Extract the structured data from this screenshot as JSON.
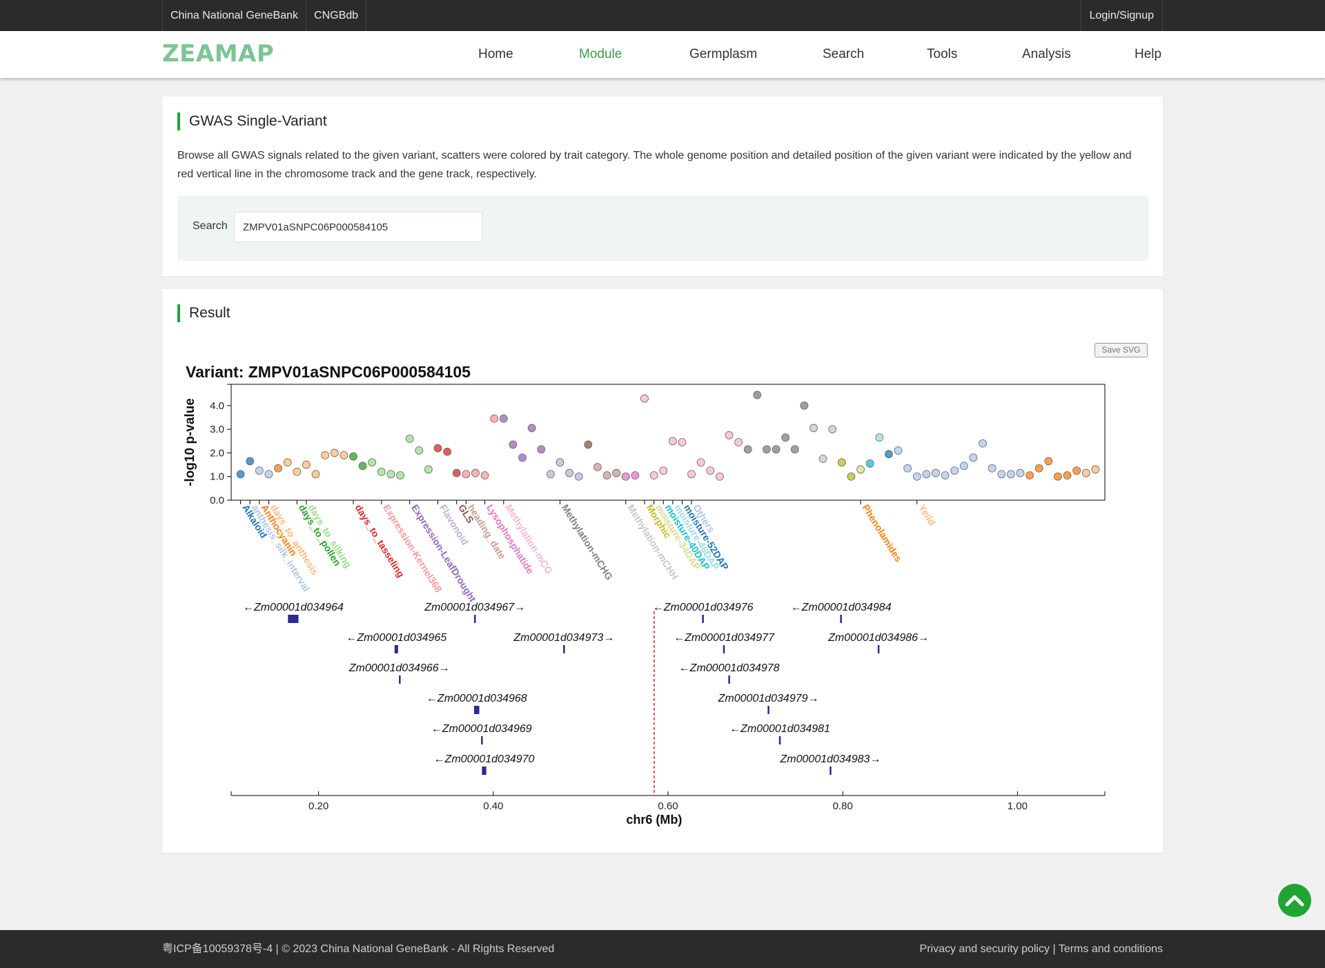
{
  "topbar": {
    "links": [
      "China National GeneBank",
      "CNGBdb"
    ],
    "login": "Login/Signup"
  },
  "header": {
    "logo": "ZEAMAP",
    "nav": [
      "Home",
      "Module",
      "Germplasm",
      "Search",
      "Tools",
      "Analysis",
      "Help"
    ],
    "active": "Module"
  },
  "section1": {
    "title": "GWAS Single-Variant",
    "description": "Browse all GWAS signals related to the given variant, scatters were colored by trait category. The whole genome position and detailed position of the given variant were indicated by the yellow and red vertical line in the chromosome track and the gene track, respectively.",
    "search_label": "Search",
    "search_value": "ZMPV01aSNPC06P000584105"
  },
  "section2": {
    "title": "Result",
    "save_button": "Save SVG"
  },
  "chart_data": [
    {
      "type": "scatter",
      "title": "Variant: ZMPV01aSNPC06P000584105",
      "ylabel": "-log10 p-value",
      "ylim": [
        0,
        4.9
      ],
      "yticks": [
        "0.0",
        "1.0",
        "2.0",
        "3.0",
        "4.0"
      ],
      "categories": [
        {
          "name": "Alkaloid",
          "color": "#1f77b4",
          "ticks": [
            1
          ],
          "labeled": true
        },
        {
          "name": "anthesis_silk_interval",
          "color": "#aec7e8",
          "ticks": [
            2
          ],
          "labeled": true
        },
        {
          "name": "Anthocyanin",
          "color": "#ff7f0e",
          "ticks": [
            3
          ],
          "labeled": true
        },
        {
          "name": "days_to_anthesis",
          "color": "#ffbb78",
          "ticks": [
            4
          ],
          "labeled": true
        },
        {
          "name": "days_to_pollen",
          "color": "#2ca02c",
          "ticks": [
            7
          ],
          "labeled": true
        },
        {
          "name": "days_to_silking",
          "color": "#98df8a",
          "ticks": [
            8
          ],
          "labeled": true
        },
        {
          "name": "days_to_tasseling",
          "color": "#d62728",
          "ticks": [
            13
          ],
          "labeled": true
        },
        {
          "name": "Expression-Kernel368",
          "color": "#ff9896",
          "ticks": [
            16
          ],
          "labeled": true
        },
        {
          "name": "Expression-LeafDrought",
          "color": "#9467bd",
          "ticks": [
            19
          ],
          "labeled": true
        },
        {
          "name": "Flavonoid",
          "color": "#c5b0d5",
          "ticks": [
            22
          ],
          "labeled": true
        },
        {
          "name": "GLS",
          "color": "#8c564b",
          "ticks": [
            24
          ],
          "labeled": true
        },
        {
          "name": "heading_date",
          "color": "#c49c94",
          "ticks": [
            25
          ],
          "labeled": true
        },
        {
          "name": "Lysophosphatide",
          "color": "#e377c2",
          "ticks": [
            27
          ],
          "labeled": true
        },
        {
          "name": "Methylation-mCG",
          "color": "#f7b6d2",
          "ticks": [
            29
          ],
          "labeled": true
        },
        {
          "name": "Methylation-mCHG",
          "color": "#7f7f7f",
          "ticks": [
            35
          ],
          "labeled": true
        },
        {
          "name": "Methylation-mCHH",
          "color": "#c7c7c7",
          "ticks": [
            42
          ],
          "labeled": true
        },
        {
          "name": "Morphic",
          "color": "#bcbd22",
          "ticks": [
            44
          ],
          "labeled": true
        },
        {
          "name": "moisture-34DAP",
          "color": "#dbdb8d",
          "ticks": [
            45
          ],
          "labeled": true
        },
        {
          "name": "moisture-40DAP",
          "color": "#17becf",
          "ticks": [
            46
          ],
          "labeled": true
        },
        {
          "name": "moisture-46DAP",
          "color": "#9edae5",
          "ticks": [
            47
          ],
          "labeled": true
        },
        {
          "name": "moisture-52DAP",
          "color": "#1f77b4",
          "ticks": [
            48
          ],
          "labeled": true
        },
        {
          "name": "Others",
          "color": "#aec7e8",
          "ticks": [
            49
          ],
          "labeled": true
        },
        {
          "name": "Phenolamides",
          "color": "#ff7f0e",
          "ticks": [
            67
          ],
          "labeled": true
        },
        {
          "name": "Yeild",
          "color": "#ffbb78",
          "ticks": [
            73
          ],
          "labeled": true
        }
      ],
      "points": [
        {
          "i": 1,
          "y": 1.1,
          "c": "#1f77b4"
        },
        {
          "i": 2,
          "y": 1.65,
          "c": "#1f77b4"
        },
        {
          "i": 3,
          "y": 1.25,
          "c": "#aec7e8"
        },
        {
          "i": 4,
          "y": 1.1,
          "c": "#aec7e8"
        },
        {
          "i": 5,
          "y": 1.35,
          "c": "#ff7f0e"
        },
        {
          "i": 6,
          "y": 1.6,
          "c": "#ffbb78"
        },
        {
          "i": 7,
          "y": 1.2,
          "c": "#ffbb78"
        },
        {
          "i": 8,
          "y": 1.5,
          "c": "#ffbb78"
        },
        {
          "i": 9,
          "y": 1.1,
          "c": "#ffbb78"
        },
        {
          "i": 10,
          "y": 1.9,
          "c": "#ffbb78"
        },
        {
          "i": 11,
          "y": 2.0,
          "c": "#ffbb78"
        },
        {
          "i": 12,
          "y": 1.9,
          "c": "#ffbb78"
        },
        {
          "i": 13,
          "y": 1.85,
          "c": "#2ca02c"
        },
        {
          "i": 14,
          "y": 1.45,
          "c": "#2ca02c"
        },
        {
          "i": 15,
          "y": 1.6,
          "c": "#98df8a"
        },
        {
          "i": 16,
          "y": 1.2,
          "c": "#98df8a"
        },
        {
          "i": 17,
          "y": 1.1,
          "c": "#98df8a"
        },
        {
          "i": 18,
          "y": 1.05,
          "c": "#98df8a"
        },
        {
          "i": 19,
          "y": 2.6,
          "c": "#98df8a"
        },
        {
          "i": 20,
          "y": 2.1,
          "c": "#98df8a"
        },
        {
          "i": 21,
          "y": 1.3,
          "c": "#98df8a"
        },
        {
          "i": 22,
          "y": 2.2,
          "c": "#d62728"
        },
        {
          "i": 23,
          "y": 2.05,
          "c": "#d62728"
        },
        {
          "i": 24,
          "y": 1.15,
          "c": "#d62728"
        },
        {
          "i": 25,
          "y": 1.1,
          "c": "#ff9896"
        },
        {
          "i": 26,
          "y": 1.15,
          "c": "#ff9896"
        },
        {
          "i": 27,
          "y": 1.05,
          "c": "#ff9896"
        },
        {
          "i": 28,
          "y": 3.45,
          "c": "#ff9896"
        },
        {
          "i": 29,
          "y": 3.45,
          "c": "#9467bd"
        },
        {
          "i": 30,
          "y": 2.35,
          "c": "#9467bd"
        },
        {
          "i": 31,
          "y": 1.8,
          "c": "#9467bd"
        },
        {
          "i": 32,
          "y": 3.05,
          "c": "#9467bd"
        },
        {
          "i": 33,
          "y": 2.15,
          "c": "#9467bd"
        },
        {
          "i": 34,
          "y": 1.1,
          "c": "#c5b0d5"
        },
        {
          "i": 35,
          "y": 1.6,
          "c": "#c5b0d5"
        },
        {
          "i": 36,
          "y": 1.15,
          "c": "#c5b0d5"
        },
        {
          "i": 37,
          "y": 1.0,
          "c": "#c5b0d5"
        },
        {
          "i": 38,
          "y": 2.35,
          "c": "#8c564b"
        },
        {
          "i": 39,
          "y": 1.4,
          "c": "#c49c94"
        },
        {
          "i": 40,
          "y": 1.05,
          "c": "#c49c94"
        },
        {
          "i": 41,
          "y": 1.15,
          "c": "#c49c94"
        },
        {
          "i": 42,
          "y": 1.0,
          "c": "#e377c2"
        },
        {
          "i": 43,
          "y": 1.05,
          "c": "#e377c2"
        },
        {
          "i": 44,
          "y": 4.3,
          "c": "#f7b6d2"
        },
        {
          "i": 45,
          "y": 1.05,
          "c": "#f7b6d2"
        },
        {
          "i": 46,
          "y": 1.25,
          "c": "#f7b6d2"
        },
        {
          "i": 47,
          "y": 2.5,
          "c": "#f7b6d2"
        },
        {
          "i": 48,
          "y": 2.45,
          "c": "#f7b6d2"
        },
        {
          "i": 49,
          "y": 1.1,
          "c": "#f7b6d2"
        },
        {
          "i": 50,
          "y": 1.6,
          "c": "#f7b6d2"
        },
        {
          "i": 51,
          "y": 1.25,
          "c": "#f7b6d2"
        },
        {
          "i": 52,
          "y": 1.0,
          "c": "#f7b6d2"
        },
        {
          "i": 53,
          "y": 2.75,
          "c": "#f7b6d2"
        },
        {
          "i": 54,
          "y": 2.45,
          "c": "#f7b6d2"
        },
        {
          "i": 55,
          "y": 2.15,
          "c": "#7f7f7f"
        },
        {
          "i": 56,
          "y": 4.45,
          "c": "#7f7f7f"
        },
        {
          "i": 57,
          "y": 2.15,
          "c": "#7f7f7f"
        },
        {
          "i": 58,
          "y": 2.15,
          "c": "#7f7f7f"
        },
        {
          "i": 59,
          "y": 2.65,
          "c": "#7f7f7f"
        },
        {
          "i": 60,
          "y": 2.15,
          "c": "#7f7f7f"
        },
        {
          "i": 61,
          "y": 4.0,
          "c": "#7f7f7f"
        },
        {
          "i": 62,
          "y": 3.05,
          "c": "#c7c7c7"
        },
        {
          "i": 63,
          "y": 1.75,
          "c": "#c7c7c7"
        },
        {
          "i": 64,
          "y": 3.0,
          "c": "#c7c7c7"
        },
        {
          "i": 65,
          "y": 1.6,
          "c": "#bcbd22"
        },
        {
          "i": 66,
          "y": 1.0,
          "c": "#bcbd22"
        },
        {
          "i": 67,
          "y": 1.3,
          "c": "#dbdb8d"
        },
        {
          "i": 68,
          "y": 1.55,
          "c": "#17becf"
        },
        {
          "i": 69,
          "y": 2.65,
          "c": "#9edae5"
        },
        {
          "i": 70,
          "y": 1.95,
          "c": "#1f77b4"
        },
        {
          "i": 71,
          "y": 2.1,
          "c": "#aec7e8"
        },
        {
          "i": 72,
          "y": 1.35,
          "c": "#aec7e8"
        },
        {
          "i": 73,
          "y": 1.0,
          "c": "#aec7e8"
        },
        {
          "i": 74,
          "y": 1.1,
          "c": "#aec7e8"
        },
        {
          "i": 75,
          "y": 1.15,
          "c": "#aec7e8"
        },
        {
          "i": 76,
          "y": 1.05,
          "c": "#aec7e8"
        },
        {
          "i": 77,
          "y": 1.25,
          "c": "#aec7e8"
        },
        {
          "i": 78,
          "y": 1.45,
          "c": "#aec7e8"
        },
        {
          "i": 79,
          "y": 1.8,
          "c": "#aec7e8"
        },
        {
          "i": 80,
          "y": 2.4,
          "c": "#aec7e8"
        },
        {
          "i": 81,
          "y": 1.35,
          "c": "#aec7e8"
        },
        {
          "i": 82,
          "y": 1.1,
          "c": "#aec7e8"
        },
        {
          "i": 83,
          "y": 1.1,
          "c": "#aec7e8"
        },
        {
          "i": 84,
          "y": 1.15,
          "c": "#aec7e8"
        },
        {
          "i": 85,
          "y": 1.05,
          "c": "#ff7f0e"
        },
        {
          "i": 86,
          "y": 1.35,
          "c": "#ff7f0e"
        },
        {
          "i": 87,
          "y": 1.65,
          "c": "#ff7f0e"
        },
        {
          "i": 88,
          "y": 1.0,
          "c": "#ff7f0e"
        },
        {
          "i": 89,
          "y": 1.05,
          "c": "#ff7f0e"
        },
        {
          "i": 90,
          "y": 1.25,
          "c": "#ff7f0e"
        },
        {
          "i": 91,
          "y": 1.15,
          "c": "#ffbb78"
        },
        {
          "i": 92,
          "y": 1.3,
          "c": "#ffbb78"
        }
      ]
    },
    {
      "type": "gene-track",
      "xlabel": "chr6 (Mb)",
      "xlim": [
        0.1,
        1.1
      ],
      "xticks": [
        "0.20",
        "0.40",
        "0.60",
        "0.80",
        "1.00"
      ],
      "variant_position": 0.5841,
      "genes": [
        {
          "name": "Zm00001d034964",
          "strand": "-",
          "start": 0.165,
          "end": 0.177,
          "row": 0
        },
        {
          "name": "Zm00001d034965",
          "strand": "-",
          "start": 0.287,
          "end": 0.291,
          "row": 1
        },
        {
          "name": "Zm00001d034966",
          "strand": "+",
          "start": 0.292,
          "end": 0.293,
          "row": 2
        },
        {
          "name": "Zm00001d034967",
          "strand": "+",
          "start": 0.378,
          "end": 0.38,
          "row": 0
        },
        {
          "name": "Zm00001d034968",
          "strand": "-",
          "start": 0.378,
          "end": 0.384,
          "row": 3
        },
        {
          "name": "Zm00001d034969",
          "strand": "-",
          "start": 0.386,
          "end": 0.387,
          "row": 4
        },
        {
          "name": "Zm00001d034970",
          "strand": "-",
          "start": 0.387,
          "end": 0.392,
          "row": 5
        },
        {
          "name": "Zm00001d034973",
          "strand": "+",
          "start": 0.48,
          "end": 0.482,
          "row": 1
        },
        {
          "name": "Zm00001d034976",
          "strand": "-",
          "start": 0.639,
          "end": 0.641,
          "row": 0
        },
        {
          "name": "Zm00001d034977",
          "strand": "-",
          "start": 0.663,
          "end": 0.665,
          "row": 1
        },
        {
          "name": "Zm00001d034978",
          "strand": "-",
          "start": 0.669,
          "end": 0.671,
          "row": 2
        },
        {
          "name": "Zm00001d034979",
          "strand": "+",
          "start": 0.714,
          "end": 0.716,
          "row": 3
        },
        {
          "name": "Zm00001d034981",
          "strand": "-",
          "start": 0.727,
          "end": 0.729,
          "row": 4
        },
        {
          "name": "Zm00001d034983",
          "strand": "+",
          "start": 0.785,
          "end": 0.787,
          "row": 5
        },
        {
          "name": "Zm00001d034984",
          "strand": "-",
          "start": 0.797,
          "end": 0.799,
          "row": 0
        },
        {
          "name": "Zm00001d034986",
          "strand": "+",
          "start": 0.84,
          "end": 0.842,
          "row": 1
        }
      ]
    }
  ],
  "footer": {
    "left": "粤ICP备10059378号-4 | © 2023 China National GeneBank - All Rights Reserved",
    "privacy": "Privacy and security policy",
    "sep": " | ",
    "terms": "Terms and conditions"
  },
  "colors": {
    "accent": "#1fa534",
    "logo": "#7cc593",
    "gene": "#2b2b8f",
    "variant_line": "#e8262a"
  },
  "icons": {
    "scroll_top": "chevron-up-icon"
  }
}
